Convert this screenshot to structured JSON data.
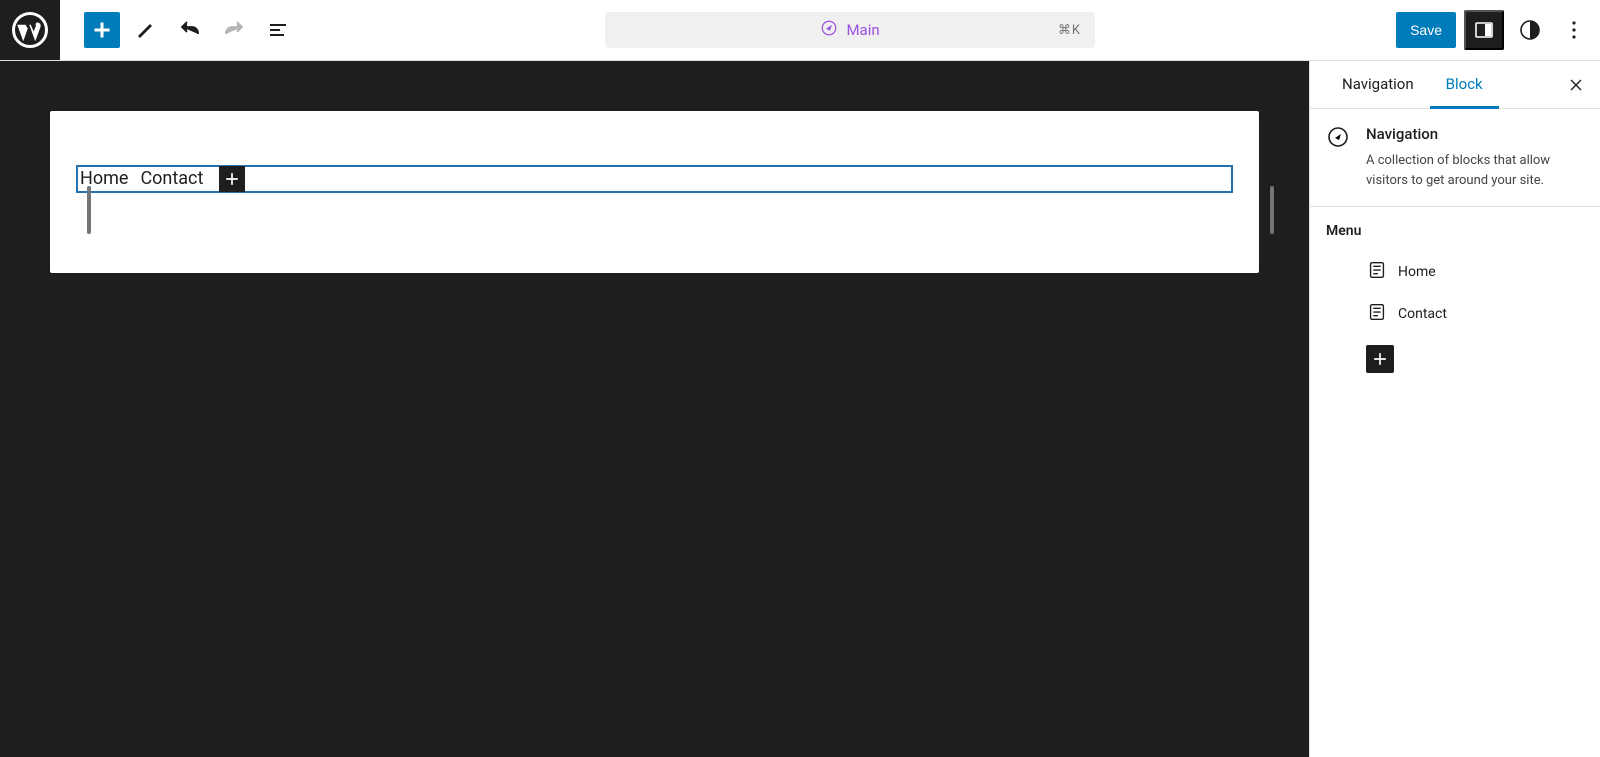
{
  "toolbar": {
    "save_label": "Save"
  },
  "breadcrumb": {
    "label": "Main",
    "shortcut": "⌘K"
  },
  "canvas": {
    "nav_items": [
      {
        "label": "Home"
      },
      {
        "label": "Contact"
      }
    ]
  },
  "sidebar": {
    "tabs": [
      {
        "label": "Navigation",
        "active": false
      },
      {
        "label": "Block",
        "active": true
      }
    ],
    "block": {
      "title": "Navigation",
      "description": "A collection of blocks that allow visitors to get around your site."
    },
    "menu": {
      "heading": "Menu",
      "items": [
        {
          "label": "Home"
        },
        {
          "label": "Contact"
        }
      ]
    }
  }
}
